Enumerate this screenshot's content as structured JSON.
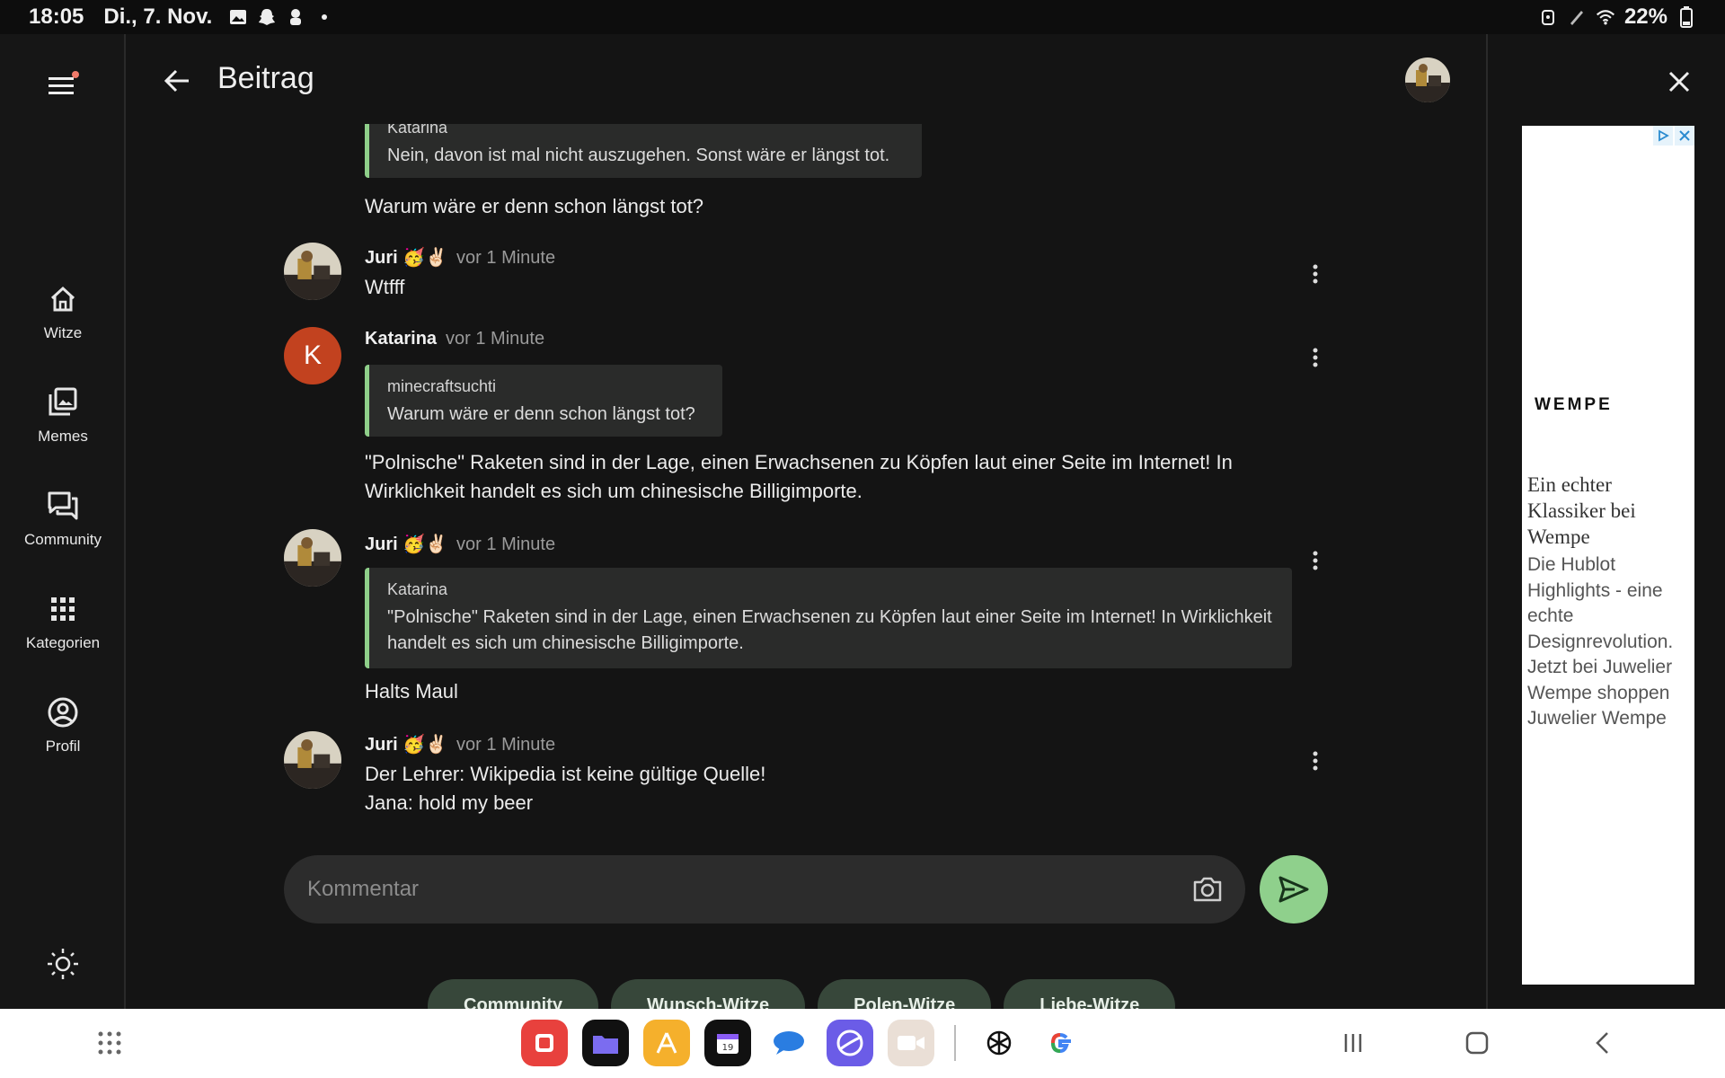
{
  "status_bar": {
    "time": "18:05",
    "date": "Di., 7. Nov.",
    "battery": "22%"
  },
  "nav_rail": {
    "items": [
      {
        "label": "Witze",
        "icon": "home-icon"
      },
      {
        "label": "Memes",
        "icon": "gallery-icon"
      },
      {
        "label": "Community",
        "icon": "forum-icon"
      },
      {
        "label": "Kategorien",
        "icon": "grid-icon"
      },
      {
        "label": "Profil",
        "icon": "account-icon"
      }
    ]
  },
  "header": {
    "title": "Beitrag"
  },
  "messages": {
    "m0": {
      "quote_author": "Katarina",
      "quote_text": "Nein, davon ist mal nicht auszugehen. Sonst wäre er längst tot.",
      "text": "Warum wäre er denn schon längst tot?"
    },
    "m1": {
      "author": "Juri 🥳✌🏻",
      "time": "vor 1 Minute",
      "text": "Wtfff"
    },
    "m2": {
      "author": "Katarina",
      "avatar_letter": "K",
      "time": "vor 1 Minute",
      "quote_author": "minecraftsuchti",
      "quote_text": "Warum wäre er denn schon längst tot?",
      "text": "\"Polnische\" Raketen sind in der Lage, einen Erwachsenen zu Köpfen laut einer Seite im Internet! In Wirklichkeit handelt es sich um chinesische Billigimporte."
    },
    "m3": {
      "author": "Juri 🥳✌🏻",
      "time": "vor 1 Minute",
      "quote_author": "Katarina",
      "quote_text": "\"Polnische\" Raketen sind in der Lage, einen Erwachsenen zu Köpfen laut einer Seite im Internet! In Wirklichkeit handelt es sich um chinesische Billigimporte.",
      "text": "Halts Maul"
    },
    "m4": {
      "author": "Juri 🥳✌🏻",
      "time": "vor 1 Minute",
      "line1": "Der Lehrer: Wikipedia ist keine gültige Quelle!",
      "line2": "Jana: hold my beer"
    }
  },
  "composer": {
    "placeholder": "Kommentar"
  },
  "chips": [
    "Community",
    "Wunsch-Witze",
    "Polen-Witze",
    "Liebe-Witze"
  ],
  "ad": {
    "brand": "WEMPE",
    "headline": "Ein echter Klassiker bei Wempe",
    "body": "Die Hublot Highlights - eine echte Designrevolution. Jetzt bei Juwelier Wempe shoppen",
    "advertiser": "Juwelier Wempe"
  },
  "colors": {
    "accent": "#8fd08c",
    "quote_bar": "#8fcf8a",
    "avatar_k": "#c2421f",
    "chip_bg": "#37473a"
  }
}
